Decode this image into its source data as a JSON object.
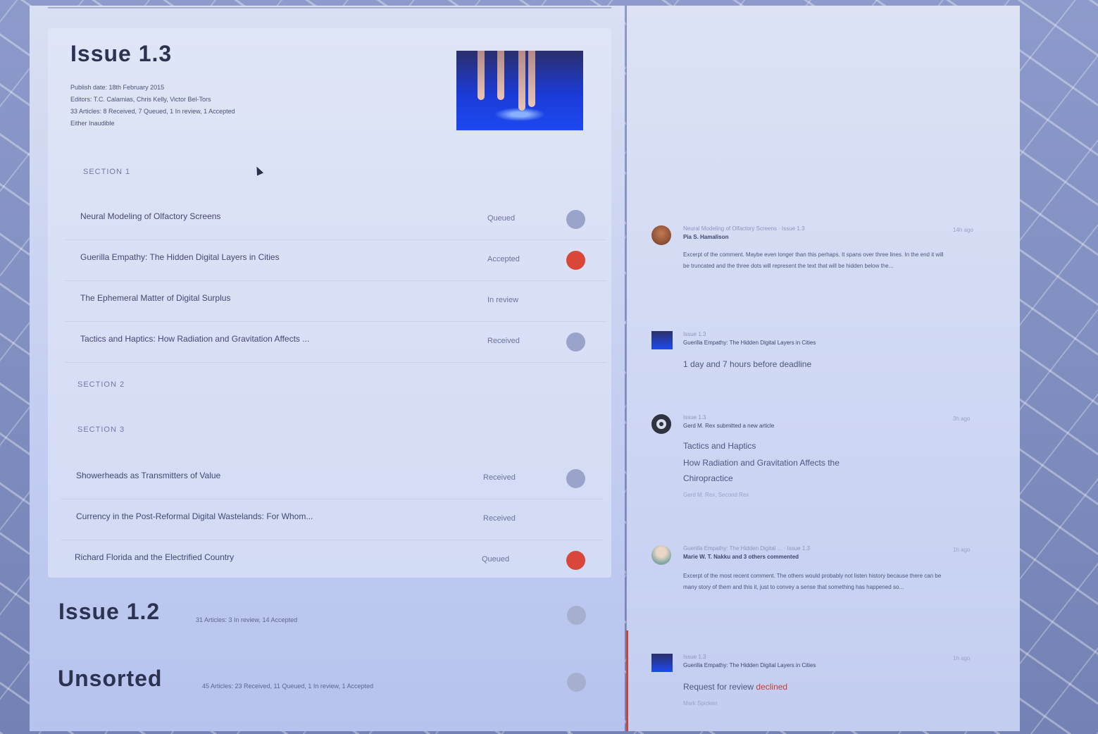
{
  "issue_1_3": {
    "title": "Issue 1.3",
    "meta": [
      "Publish date: 18th February 2015",
      "Editors: T.C. Calamias, Chris Kelly, Victor Bel-Tors",
      "33 Articles: 8 Received, 7 Queued, 1 In review, 1 Accepted",
      "Either Inaudible"
    ],
    "section_1_label": "SECTION 1",
    "section_2_label": "SECTION 2",
    "section_3_label": "SECTION 3",
    "rows": [
      {
        "title": "Neural Modeling of Olfactory Screens",
        "status": "Queued"
      },
      {
        "title": "Guerilla Empathy: The Hidden Digital Layers in Cities",
        "status": "Accepted"
      },
      {
        "title": "The Ephemeral Matter of Digital Surplus",
        "status": "In review"
      },
      {
        "title": "Tactics and Haptics: How Radiation and Gravitation Affects ...",
        "status": "Received"
      },
      {
        "title": "Showerheads as Transmitters of Value",
        "status": "Received"
      },
      {
        "title": "Currency in the Post-Reformal Digital Wastelands: For Whom...",
        "status": "Received"
      },
      {
        "title": "Richard Florida and the Electrified Country",
        "status": "Queued"
      }
    ]
  },
  "issue_1_2": {
    "title": "Issue 1.2",
    "meta": "31 Articles: 3 In review, 14 Accepted"
  },
  "unsorted": {
    "title": "Unsorted",
    "meta": "45 Articles: 23 Received, 11 Queued, 1 In review, 1 Accepted"
  },
  "feed": [
    {
      "ref": "Neural Modeling of Olfactory Screens · Issue 1.3",
      "who": "Pia S. Hamalison",
      "body": "Excerpt of the comment. Maybe even longer than this perhaps. It spans over three lines. In the end it will be truncated and the three dots will represent the text that will be hidden below the...",
      "time": "14h ago"
    },
    {
      "ref": "Issue 1.3",
      "who": "Guerilla Empathy: The Hidden Digital Layers in Cities",
      "big": "1 day and 7 hours before deadline"
    },
    {
      "ref": "Issue 1.3",
      "who": "Gerd M. Rex submitted a new article",
      "big_1": "Tactics and Haptics",
      "big_2": "How Radiation and Gravitation Affects the",
      "big_3": "Chiropractice",
      "small": "Gerd M. Rex, Second Rex",
      "time": "3h ago"
    },
    {
      "ref": "Guerilla Empathy: The Hidden Digital ... · Issue 1.3",
      "who": "Marie W. T. Nakku and 3 others commented",
      "body": "Excerpt of the most recent comment. The others would probably not listen history because there can be many story of them and this it, just to convey a sense that something has happened so...",
      "time": "1h ago"
    },
    {
      "ref": "Issue 1.3",
      "who": "Guerilla Empathy: The Hidden Digital Layers in Cities",
      "big_prefix": "Request for review",
      "big_status": "declined",
      "small": "Mark Spicken",
      "time": "1h ago"
    }
  ],
  "colors": {
    "accent_red": "#d9473a",
    "status_grey": "#9aa3c9"
  }
}
